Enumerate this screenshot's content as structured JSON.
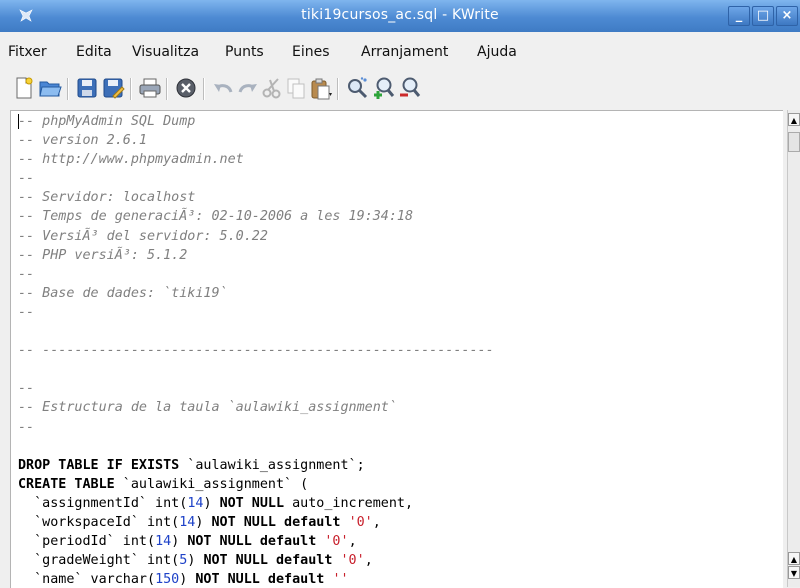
{
  "window": {
    "title": "tiki19cursos_ac.sql - KWrite",
    "buttons": {
      "minimize": "_",
      "maximize": "□",
      "close": "×"
    }
  },
  "menu": {
    "items": [
      "Fitxer",
      "Edita",
      "Visualitza",
      "Punts",
      "Eines",
      "Arranjament",
      "Ajuda"
    ]
  },
  "toolbar": {
    "icons": [
      "new-document-icon",
      "open-folder-icon",
      "save-icon",
      "save-as-icon",
      "print-icon",
      "close-document-icon",
      "undo-icon",
      "redo-icon",
      "cut-icon",
      "copy-icon",
      "paste-icon",
      "find-icon",
      "zoom-in-icon",
      "zoom-out-icon"
    ]
  },
  "editor": {
    "lines": [
      [
        {
          "t": "-- phpMyAdmin SQL Dump",
          "c": "cm"
        }
      ],
      [
        {
          "t": "-- version 2.6.1",
          "c": "cm"
        }
      ],
      [
        {
          "t": "-- http://www.phpmyadmin.net",
          "c": "cm"
        }
      ],
      [
        {
          "t": "-- ",
          "c": "cm"
        }
      ],
      [
        {
          "t": "-- Servidor: localhost",
          "c": "cm"
        }
      ],
      [
        {
          "t": "-- Temps de generaciÃ³: 02-10-2006 a les 19:34:18",
          "c": "cm"
        }
      ],
      [
        {
          "t": "-- VersiÃ³ del servidor: 5.0.22",
          "c": "cm"
        }
      ],
      [
        {
          "t": "-- PHP versiÃ³: 5.1.2",
          "c": "cm"
        }
      ],
      [
        {
          "t": "-- ",
          "c": "cm"
        }
      ],
      [
        {
          "t": "-- Base de dades: `tiki19`",
          "c": "cm"
        }
      ],
      [
        {
          "t": "-- ",
          "c": "cm"
        }
      ],
      [],
      [
        {
          "t": "-- --------------------------------------------------------",
          "c": "cm"
        }
      ],
      [],
      [
        {
          "t": "-- ",
          "c": "cm"
        }
      ],
      [
        {
          "t": "-- Estructura de la taula `aulawiki_assignment`",
          "c": "cm"
        }
      ],
      [
        {
          "t": "-- ",
          "c": "cm"
        }
      ],
      [],
      [
        {
          "t": "DROP TABLE IF EXISTS",
          "c": "kw"
        },
        {
          "t": " `aulawiki_assignment`;",
          "c": ""
        }
      ],
      [
        {
          "t": "CREATE TABLE",
          "c": "kw"
        },
        {
          "t": " `aulawiki_assignment` (",
          "c": ""
        }
      ],
      [
        {
          "t": "  `assignmentId` int(",
          "c": ""
        },
        {
          "t": "14",
          "c": "num"
        },
        {
          "t": ") ",
          "c": ""
        },
        {
          "t": "NOT NULL",
          "c": "kw"
        },
        {
          "t": " auto_increment,",
          "c": ""
        }
      ],
      [
        {
          "t": "  `workspaceId` int(",
          "c": ""
        },
        {
          "t": "14",
          "c": "num"
        },
        {
          "t": ") ",
          "c": ""
        },
        {
          "t": "NOT NULL default",
          "c": "kw"
        },
        {
          "t": " ",
          "c": ""
        },
        {
          "t": "'0'",
          "c": "str"
        },
        {
          "t": ",",
          "c": ""
        }
      ],
      [
        {
          "t": "  `periodId` int(",
          "c": ""
        },
        {
          "t": "14",
          "c": "num"
        },
        {
          "t": ") ",
          "c": ""
        },
        {
          "t": "NOT NULL default",
          "c": "kw"
        },
        {
          "t": " ",
          "c": ""
        },
        {
          "t": "'0'",
          "c": "str"
        },
        {
          "t": ",",
          "c": ""
        }
      ],
      [
        {
          "t": "  `gradeWeight` int(",
          "c": ""
        },
        {
          "t": "5",
          "c": "num"
        },
        {
          "t": ") ",
          "c": ""
        },
        {
          "t": "NOT NULL default",
          "c": "kw"
        },
        {
          "t": " ",
          "c": ""
        },
        {
          "t": "'0'",
          "c": "str"
        },
        {
          "t": ",",
          "c": ""
        }
      ],
      [
        {
          "t": "  `name` varchar(",
          "c": ""
        },
        {
          "t": "150",
          "c": "num"
        },
        {
          "t": ") ",
          "c": ""
        },
        {
          "t": "NOT NULL default",
          "c": "kw"
        },
        {
          "t": " ",
          "c": ""
        },
        {
          "t": "''",
          "c": "str"
        }
      ]
    ]
  },
  "scrollbar": {
    "up": "▲",
    "down": "▼"
  }
}
